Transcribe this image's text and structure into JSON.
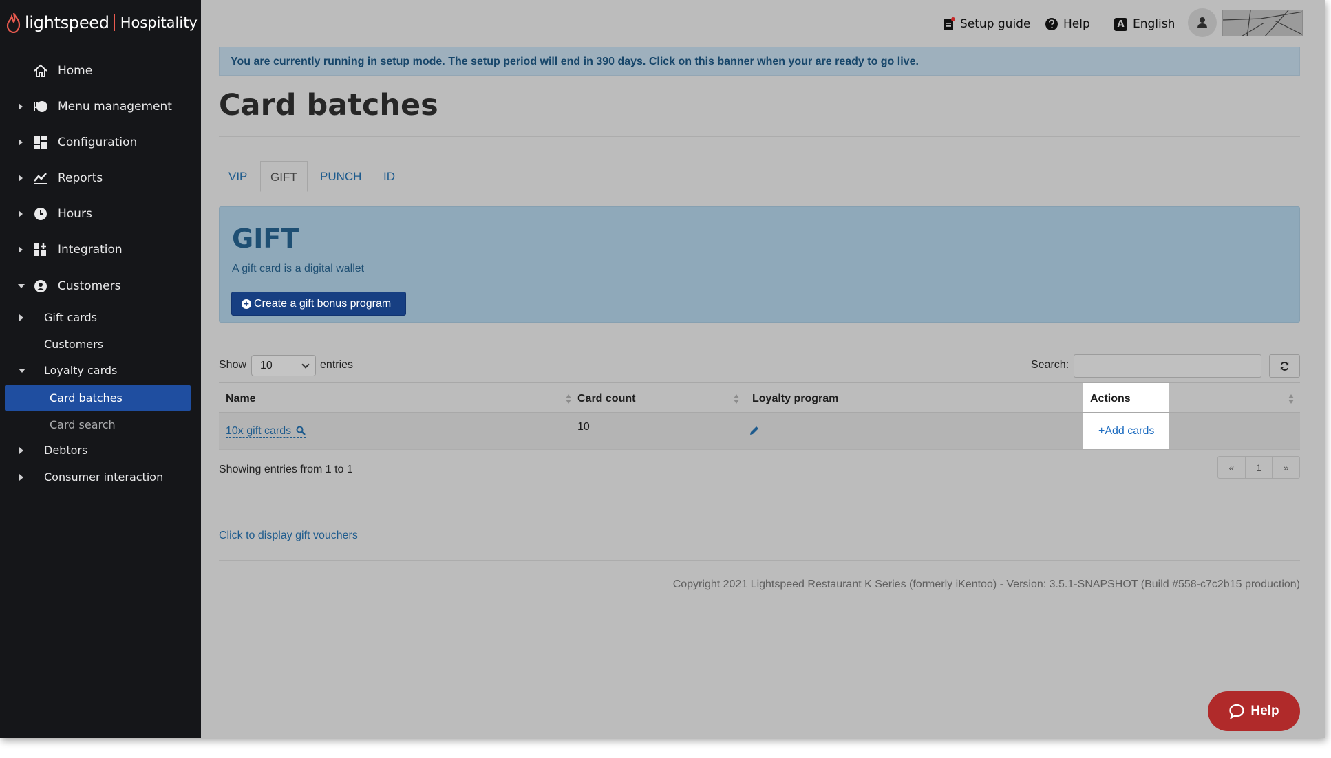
{
  "brand": {
    "name": "lightspeed",
    "product": "Hospitality"
  },
  "topbar": {
    "setup_guide": "Setup guide",
    "help": "Help",
    "language_icon_letter": "A",
    "language": "English"
  },
  "sidebar": {
    "items": [
      {
        "label": "Home",
        "icon": "home-icon"
      },
      {
        "label": "Menu management",
        "icon": "menu-management-icon"
      },
      {
        "label": "Configuration",
        "icon": "configuration-icon"
      },
      {
        "label": "Reports",
        "icon": "reports-icon"
      },
      {
        "label": "Hours",
        "icon": "clock-icon"
      },
      {
        "label": "Integration",
        "icon": "integration-icon"
      },
      {
        "label": "Customers",
        "icon": "user-circle-icon"
      }
    ],
    "sub": {
      "gift_cards": "Gift cards",
      "customers": "Customers",
      "loyalty_cards": "Loyalty cards",
      "card_batches": "Card batches",
      "card_search": "Card search",
      "debtors": "Debtors",
      "consumer_interaction": "Consumer interaction"
    }
  },
  "banner": {
    "text": "You are currently running in setup mode. The setup period will end in 390 days. Click on this banner when your are ready to go live."
  },
  "page": {
    "title": "Card batches"
  },
  "tabs": [
    {
      "label": "VIP"
    },
    {
      "label": "GIFT"
    },
    {
      "label": "PUNCH"
    },
    {
      "label": "ID"
    }
  ],
  "gift_panel": {
    "title": "GIFT",
    "description": "A gift card is a digital wallet",
    "create_button": "Create a gift bonus program"
  },
  "table_controls": {
    "show": "Show",
    "page_length": "10",
    "entries": "entries",
    "search_label": "Search:"
  },
  "table": {
    "headers": [
      "Name",
      "Card count",
      "Loyalty program",
      "Actions"
    ],
    "rows": [
      {
        "name": "10x gift cards",
        "card_count": "10",
        "action": "+Add cards"
      }
    ]
  },
  "pagination": {
    "summary": "Showing entries from 1 to 1",
    "prev": "«",
    "page": "1",
    "next": "»"
  },
  "links": {
    "display_vouchers": "Click to display gift vouchers"
  },
  "footer": {
    "copyright": "Copyright 2021 Lightspeed Restaurant K Series (formerly iKentoo) - Version: 3.5.1-SNAPSHOT (Build #558-c7c2b15 production)"
  },
  "help_fab": {
    "label": "Help"
  },
  "colors": {
    "sidebar_bg": "#151619",
    "active_nav": "#1f4ea0",
    "brand_red": "#e85a4f",
    "primary_button": "#173f82",
    "link": "#1e5b8d",
    "help_fab": "#b02a2a"
  }
}
